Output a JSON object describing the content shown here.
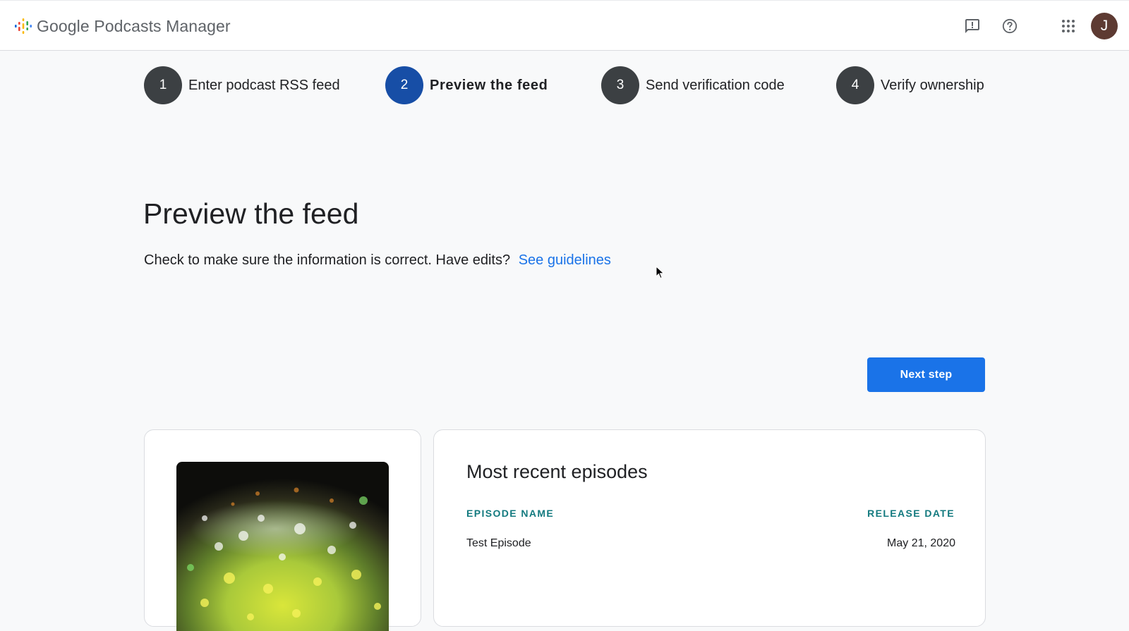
{
  "header": {
    "app_name": "Google Podcasts Manager",
    "avatar_initial": "J",
    "icons": [
      "feedback-icon",
      "help-icon",
      "apps-grid-icon"
    ]
  },
  "stepper": {
    "steps": [
      {
        "number": "1",
        "label": "Enter podcast RSS feed",
        "state": "done"
      },
      {
        "number": "2",
        "label": "Preview the feed",
        "state": "active"
      },
      {
        "number": "3",
        "label": "Send verification code",
        "state": "upcoming"
      },
      {
        "number": "4",
        "label": "Verify ownership",
        "state": "upcoming"
      }
    ]
  },
  "main": {
    "title": "Preview the feed",
    "description": "Check to make sure the information is correct. Have edits?",
    "guidelines_link": "See guidelines",
    "next_button": "Next step"
  },
  "episodes": {
    "title": "Most recent episodes",
    "columns": [
      "EPISODE NAME",
      "RELEASE DATE"
    ],
    "rows": [
      {
        "name": "Test Episode",
        "release_date": "May 21, 2020"
      }
    ]
  },
  "colors": {
    "accent": "#1a73e8",
    "active_step": "#174ea6",
    "step_default": "#3c4043",
    "column_header": "#137a7f",
    "avatar_bg": "#5d3a32"
  }
}
